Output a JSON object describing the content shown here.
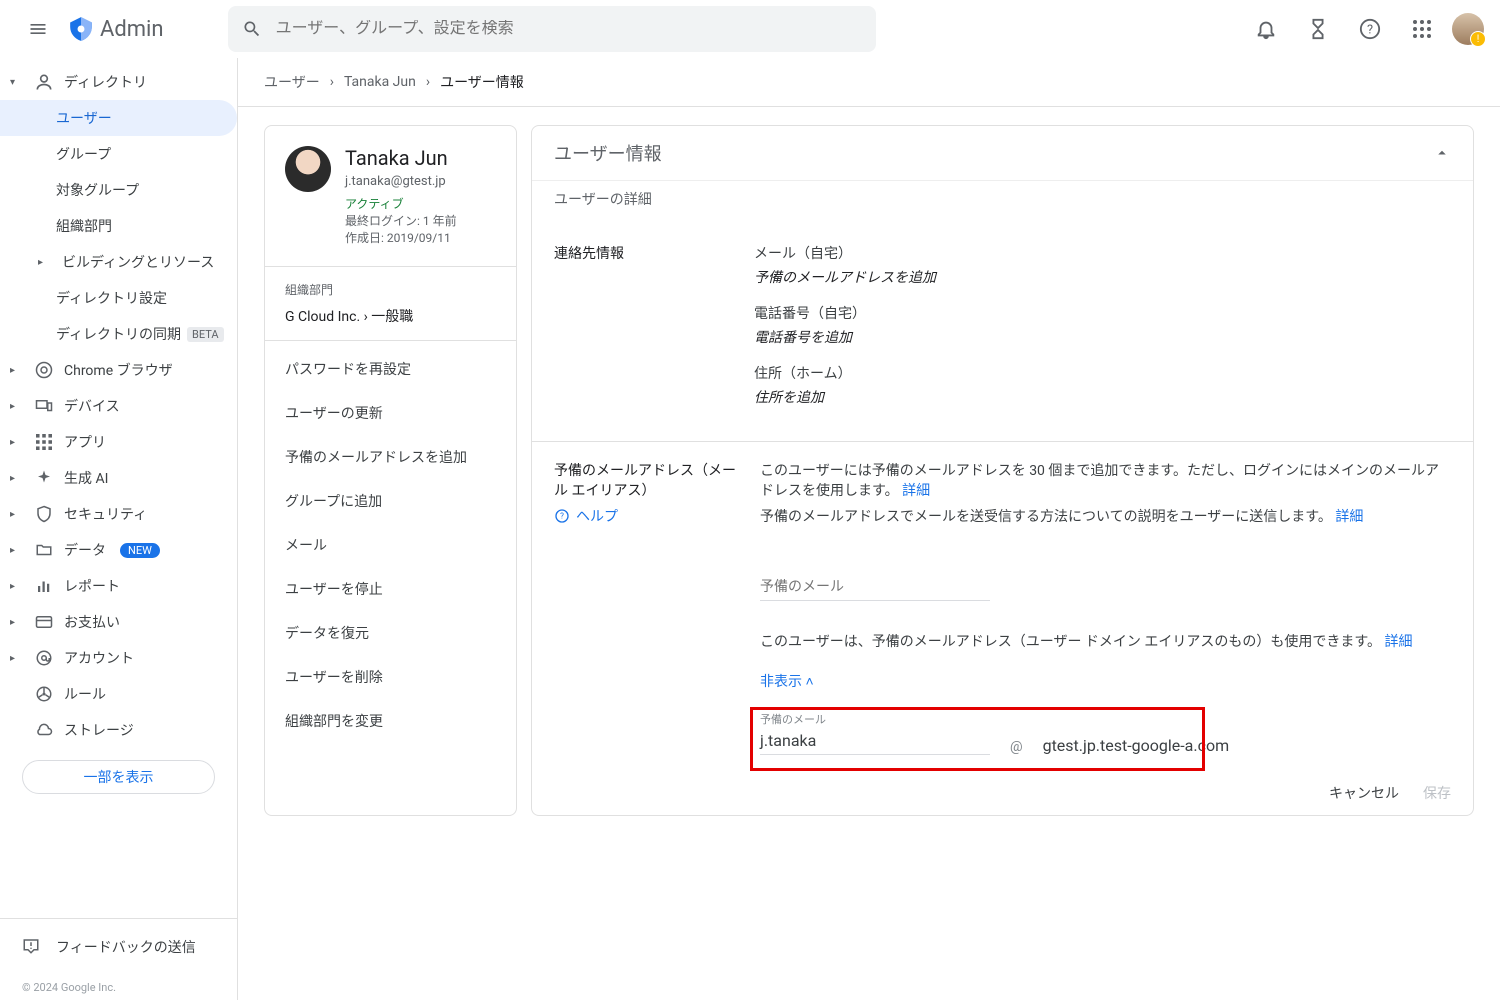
{
  "header": {
    "brand": "Admin",
    "search_placeholder": "ユーザー、グループ、設定を検索"
  },
  "sidebar": {
    "directory": "ディレクトリ",
    "users": "ユーザー",
    "groups": "グループ",
    "target_groups": "対象グループ",
    "org_units": "組織部門",
    "building": "ビルディングとリソース",
    "dir_settings": "ディレクトリ設定",
    "dir_sync": "ディレクトリの同期",
    "beta": "BETA",
    "chrome": "Chrome ブラウザ",
    "devices": "デバイス",
    "apps": "アプリ",
    "gen_ai": "生成 AI",
    "security": "セキュリティ",
    "data": "データ",
    "new": "NEW",
    "reports": "レポート",
    "billing": "お支払い",
    "account": "アカウント",
    "rules": "ルール",
    "storage": "ストレージ",
    "show_less": "一部を表示",
    "feedback": "フィードバックの送信",
    "copyright": "© 2024 Google Inc."
  },
  "breadcrumb": {
    "a": "ユーザー",
    "b": "Tanaka Jun",
    "c": "ユーザー情報"
  },
  "user": {
    "name": "Tanaka Jun",
    "email": "j.tanaka@gtest.jp",
    "status": "アクティブ",
    "last_login": "最終ログイン: 1 年前",
    "created": "作成日: 2019/09/11",
    "org_label": "組織部門",
    "org_path": "G Cloud Inc.  ›  一般職"
  },
  "actions": {
    "reset_pw": "パスワードを再設定",
    "update_user": "ユーザーの更新",
    "add_alias": "予備のメールアドレスを追加",
    "add_group": "グループに追加",
    "mail": "メール",
    "suspend": "ユーザーを停止",
    "restore": "データを復元",
    "delete": "ユーザーを削除",
    "change_org": "組織部門を変更"
  },
  "right": {
    "title": "ユーザー情報",
    "subtitle": "ユーザーの詳細",
    "contact_label": "連絡先情報",
    "mail_home": "メール（自宅）",
    "mail_add": "予備のメールアドレスを追加",
    "phone_home": "電話番号（自宅）",
    "phone_add": "電話番号を追加",
    "addr_home": "住所（ホーム）",
    "addr_add": "住所を追加"
  },
  "alias": {
    "title": "予備のメールアドレス（メール エイリアス）",
    "help": "ヘルプ",
    "desc1a": "このユーザーには予備のメールアドレスを 30 個まで追加できます。ただし、ログインにはメインのメールアドレスを使用します。",
    "details": "詳細",
    "desc2a": "予備のメールアドレスでメールを送受信する方法についての説明をユーザーに送信します。",
    "input_label": "予備のメール",
    "desc3": "このユーザーは、予備のメールアドレス（ユーザー ドメイン エイリアスのもの）も使用できます。",
    "hide": "非表示",
    "alias_label": "予備のメール",
    "alias_user": "j.tanaka",
    "at": "@",
    "alias_domain": "gtest.jp.test-google-a.com",
    "cancel": "キャンセル",
    "save": "保存"
  }
}
